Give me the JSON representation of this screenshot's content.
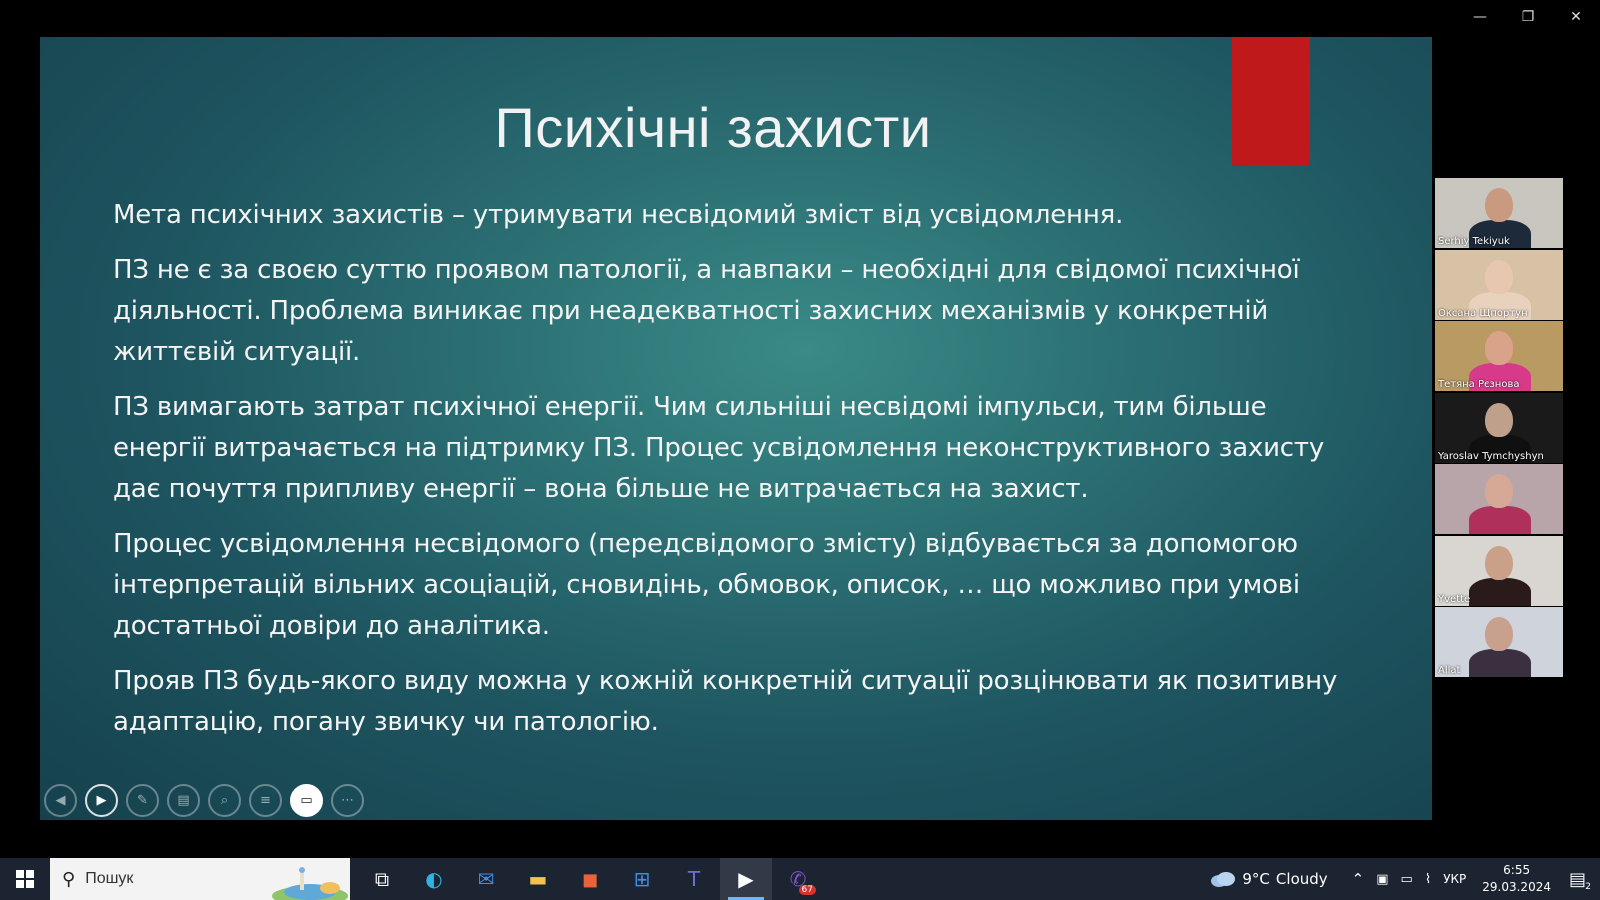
{
  "window_controls": {
    "minimize": "—",
    "restore": "❐",
    "close": "✕"
  },
  "slide": {
    "title": "Психічні захисти",
    "accent_color": "#c0191c",
    "paragraphs": [
      "Мета психічних захистів – утримувати несвідомий зміст від усвідомлення.",
      "ПЗ не є за своєю суттю проявом патології, а навпаки – необхідні для свідомої психічної діяльності. Проблема виникає при неадекватності захисних механізмів у конкретній життєвій ситуації.",
      "ПЗ вимагають затрат психічної енергії. Чим сильніші несвідомі імпульси, тим більше енергії витрачається на підтримку ПЗ. Процес усвідомлення неконструктивного захисту дає почуття припливу енергії – вона більше не витрачається на захист.",
      "Процес усвідомлення несвідомого (передсвідомого змісту) відбувається за допомогою інтерпретацій вільних асоціацій, сновидінь, обмовок, описок, … що можливо при умові достатньої довіри до аналітика.",
      "Прояв ПЗ будь-якого виду можна у кожній конкретній ситуації розцінювати як позитивну адаптацію, погану звичку чи патологію."
    ]
  },
  "slide_toolbar": [
    {
      "name": "previous-button",
      "icon": "prev-icon",
      "glyph": "◀"
    },
    {
      "name": "next-button",
      "icon": "play-icon",
      "glyph": "▶"
    },
    {
      "name": "pen-button",
      "icon": "pen-icon",
      "glyph": "✎"
    },
    {
      "name": "slides-button",
      "icon": "slides-icon",
      "glyph": "▤"
    },
    {
      "name": "zoom-button",
      "icon": "zoom-icon",
      "glyph": "⌕"
    },
    {
      "name": "subtitles-button",
      "icon": "subtitles-icon",
      "glyph": "≡"
    },
    {
      "name": "camera-button",
      "icon": "camera-icon",
      "glyph": "▭"
    },
    {
      "name": "more-button",
      "icon": "more-icon",
      "glyph": "⋯"
    }
  ],
  "participants": [
    {
      "name": "Serhiy Tekiyuk",
      "bg": "#c9c6c0",
      "face": "#c99a80",
      "body": "#1d2a3a"
    },
    {
      "name": "Оксана Щпортун",
      "bg": "#d8c2a5",
      "face": "#e8c7b0",
      "body": "#e8d2bd"
    },
    {
      "name": "Тетяна Рєзнова",
      "bg": "#b99a63",
      "face": "#d9a38a",
      "body": "#d83a8a"
    },
    {
      "name": "Yaroslav Tymchyshyn",
      "bg": "#1a1a1a",
      "face": "#bfa08a",
      "body": "#101010"
    },
    {
      "name": "",
      "bg": "#b7a5a9",
      "face": "#d6a996",
      "body": "#b0305c"
    },
    {
      "name": "Yvette",
      "bg": "#d9d6d2",
      "face": "#caa089",
      "body": "#2a1a1a"
    },
    {
      "name": "Allat",
      "bg": "#cfd3db",
      "face": "#c9a08d",
      "body": "#3a3040"
    }
  ],
  "taskbar": {
    "search_placeholder": "Пошук",
    "apps": [
      {
        "name": "task-view",
        "icon": "task-view-icon",
        "glyph": "⧉",
        "color": "#ffffff"
      },
      {
        "name": "edge",
        "icon": "edge-icon",
        "glyph": "◐",
        "color": "#2fb3e6"
      },
      {
        "name": "mail",
        "icon": "mail-icon",
        "glyph": "✉",
        "color": "#3c8ee8"
      },
      {
        "name": "file-explorer",
        "icon": "folder-icon",
        "glyph": "▬",
        "color": "#f2c14e"
      },
      {
        "name": "office",
        "icon": "office-icon",
        "glyph": "◼",
        "color": "#e8623a"
      },
      {
        "name": "store",
        "icon": "store-icon",
        "glyph": "⊞",
        "color": "#3c8ee8"
      },
      {
        "name": "teams",
        "icon": "teams-icon",
        "glyph": "T",
        "color": "#6b6fd6"
      },
      {
        "name": "slideshow",
        "icon": "play-icon",
        "glyph": "▶",
        "color": "#ffffff",
        "active": true
      },
      {
        "name": "viber",
        "icon": "viber-icon",
        "glyph": "✆",
        "color": "#7d52c7",
        "badge": "67"
      }
    ],
    "weather": {
      "temp": "9°C",
      "condition": "Cloudy"
    },
    "language": "УКР",
    "time": "6:55",
    "date": "29.03.2024",
    "notifications_badge": "2"
  }
}
